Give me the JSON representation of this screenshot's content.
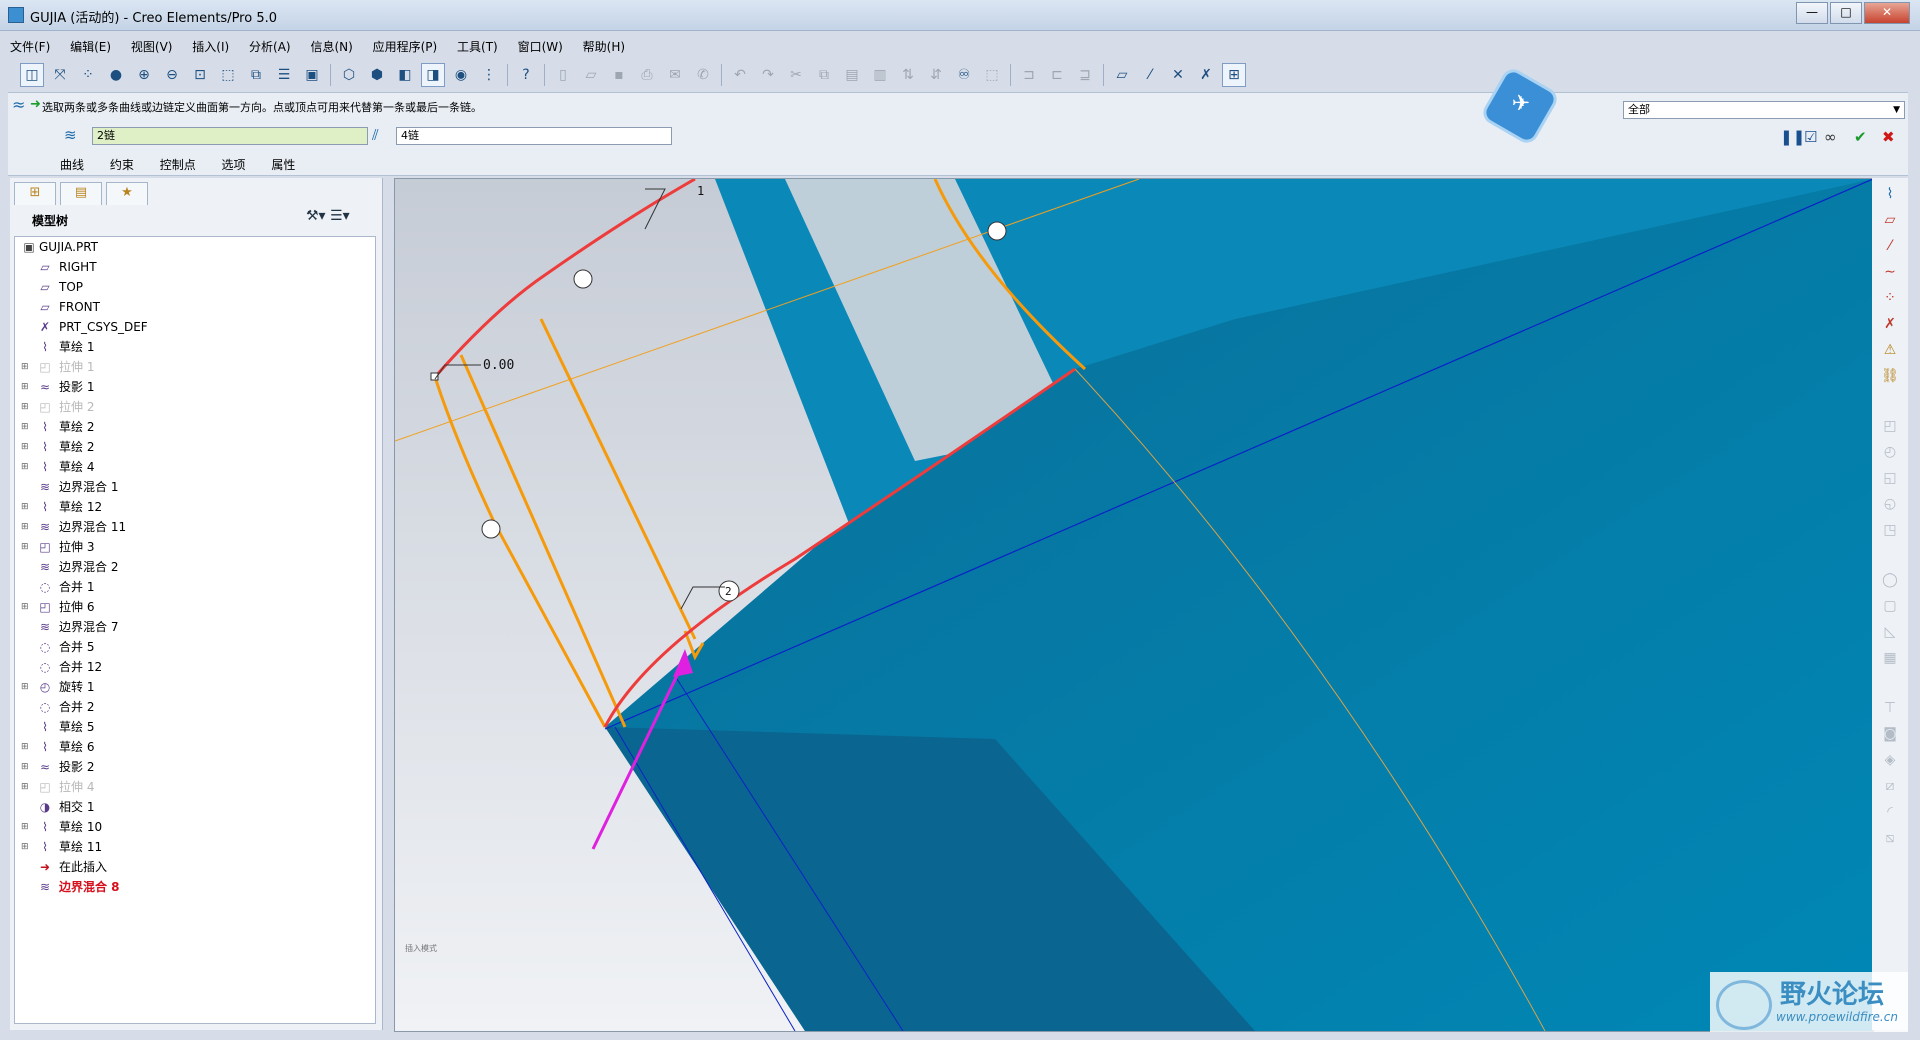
{
  "window": {
    "title": "GUJIA (活动的) - Creo Elements/Pro 5.0",
    "controls": [
      "—",
      "□",
      "✕"
    ]
  },
  "menu": [
    "文件(F)",
    "编辑(E)",
    "视图(V)",
    "插入(I)",
    "分析(A)",
    "信息(N)",
    "应用程序(P)",
    "工具(T)",
    "窗口(W)",
    "帮助(H)"
  ],
  "dashboard": {
    "prompt": "选取两条或多条曲线或边链定义曲面第一方向。点或顶点可用来代替第一条或最后一条链。",
    "chain1": "2链",
    "chain2": "4链",
    "tabs": [
      "曲线",
      "约束",
      "控制点",
      "选项",
      "属性"
    ],
    "filter": "全部",
    "controls": [
      "❚❚",
      "☑",
      "∞",
      "✔",
      "✖"
    ]
  },
  "model_tree": {
    "header": "模型树",
    "items": [
      {
        "label": "GUJIA.PRT",
        "type": "root"
      },
      {
        "label": "RIGHT",
        "type": "plane"
      },
      {
        "label": "TOP",
        "type": "plane"
      },
      {
        "label": "FRONT",
        "type": "plane"
      },
      {
        "label": "PRT_CSYS_DEF",
        "type": "csys"
      },
      {
        "label": "草绘 1",
        "type": "sketch"
      },
      {
        "label": "拉伸 1",
        "type": "extrude",
        "disabled": true,
        "expandable": true
      },
      {
        "label": "投影 1",
        "type": "project",
        "expandable": true
      },
      {
        "label": "拉伸 2",
        "type": "extrude",
        "disabled": true,
        "expandable": true
      },
      {
        "label": "草绘 2",
        "type": "sketch",
        "expandable": true
      },
      {
        "label": "草绘 2",
        "type": "sketch",
        "expandable": true
      },
      {
        "label": "草绘 4",
        "type": "sketch",
        "expandable": true
      },
      {
        "label": "边界混合 1",
        "type": "blend"
      },
      {
        "label": "草绘 12",
        "type": "sketch",
        "expandable": true
      },
      {
        "label": "边界混合 11",
        "type": "blend",
        "expandable": true
      },
      {
        "label": "拉伸 3",
        "type": "extrude",
        "expandable": true
      },
      {
        "label": "边界混合 2",
        "type": "blend"
      },
      {
        "label": "合并 1",
        "type": "merge"
      },
      {
        "label": "拉伸 6",
        "type": "extrude",
        "expandable": true
      },
      {
        "label": "边界混合 7",
        "type": "blend"
      },
      {
        "label": "合并 5",
        "type": "merge"
      },
      {
        "label": "合并 12",
        "type": "merge"
      },
      {
        "label": "旋转 1",
        "type": "revolve",
        "expandable": true
      },
      {
        "label": "合并 2",
        "type": "merge"
      },
      {
        "label": "草绘 5",
        "type": "sketch"
      },
      {
        "label": "草绘 6",
        "type": "sketch",
        "expandable": true
      },
      {
        "label": "投影 2",
        "type": "project",
        "expandable": true
      },
      {
        "label": "拉伸 4",
        "type": "extrude",
        "disabled": true,
        "expandable": true
      },
      {
        "label": "相交 1",
        "type": "intersect"
      },
      {
        "label": "草绘 10",
        "type": "sketch",
        "expandable": true
      },
      {
        "label": "草绘 11",
        "type": "sketch",
        "expandable": true
      },
      {
        "label": "在此插入",
        "type": "insert"
      },
      {
        "label": "边界混合 8",
        "type": "blend",
        "active": true
      }
    ]
  },
  "viewport": {
    "labels": [
      "1",
      "0.00",
      "2"
    ],
    "small_note": "插入模式"
  },
  "watermark": {
    "title": "野火论坛",
    "url": "www.proewildfire.cn"
  },
  "colors": {
    "surface": "#0089b8",
    "chain_red": "#ee3b3b",
    "chain_orange": "#f59a0b",
    "arrow": "#e020e0",
    "datum": "#0022cc"
  }
}
